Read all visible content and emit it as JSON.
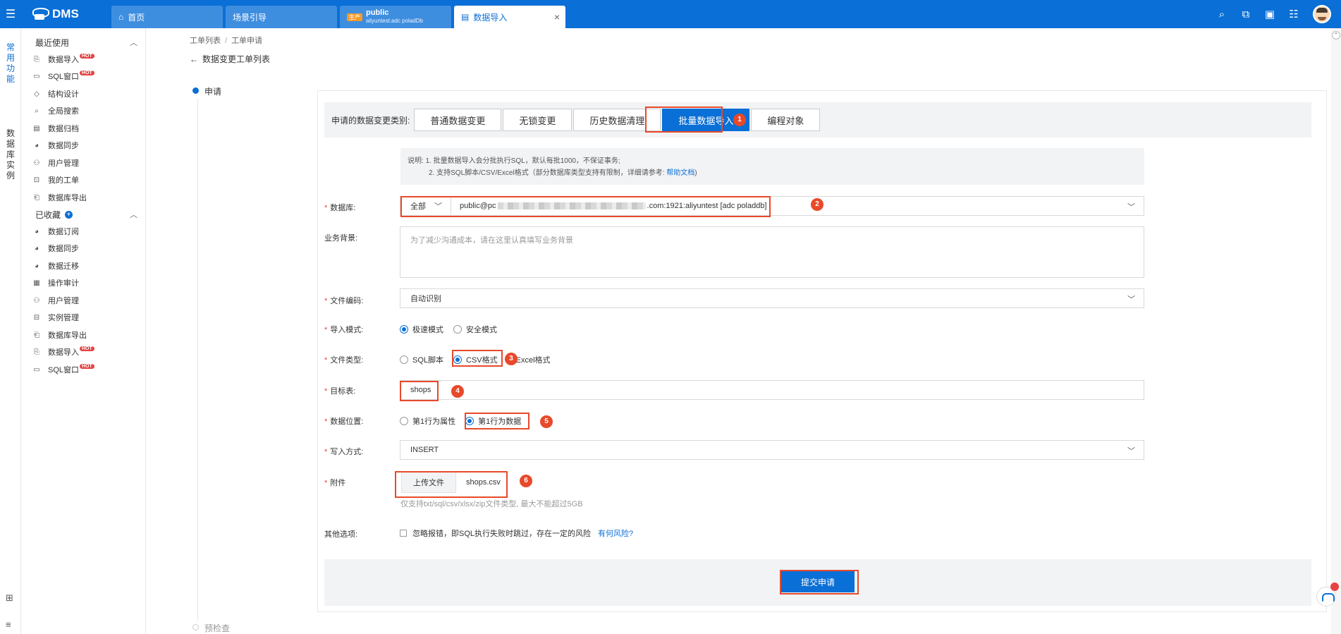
{
  "app": {
    "title": "DMS"
  },
  "tabs": [
    {
      "label": "首页"
    },
    {
      "label": "场景引导"
    },
    {
      "env": "生产",
      "label": "public",
      "sub": "aliyuntest:adc poladDb"
    },
    {
      "label": "数据导入"
    }
  ],
  "rail": {
    "item1": [
      "常",
      "用",
      "功",
      "能"
    ],
    "item2": [
      "数",
      "据",
      "库",
      "实",
      "例"
    ]
  },
  "sidebar": {
    "recent_title": "最近使用",
    "recent": [
      {
        "label": "数据导入",
        "hot": "HOT"
      },
      {
        "label": "SQL窗口",
        "hot": "HOT"
      },
      {
        "label": "结构设计"
      },
      {
        "label": "全局搜索"
      },
      {
        "label": "数据归档"
      },
      {
        "label": "数据同步"
      },
      {
        "label": "用户管理"
      },
      {
        "label": "我的工单"
      },
      {
        "label": "数据库导出"
      }
    ],
    "fav_title": "已收藏",
    "fav": [
      {
        "label": "数据订阅"
      },
      {
        "label": "数据同步"
      },
      {
        "label": "数据迁移"
      },
      {
        "label": "操作审计"
      },
      {
        "label": "用户管理"
      },
      {
        "label": "实例管理"
      },
      {
        "label": "数据库导出"
      },
      {
        "label": "数据导入",
        "hot": "HOT"
      },
      {
        "label": "SQL窗口",
        "hot": "HOT"
      }
    ]
  },
  "breadcrumb": {
    "item1": "工单列表",
    "sep": "/",
    "item2": "工单申请"
  },
  "back_title": "数据变更工单列表",
  "steps": {
    "apply": "申请",
    "precheck": "预检查"
  },
  "change_type": {
    "label": "申请的数据变更类别:",
    "options": [
      "普通数据变更",
      "无锁变更",
      "历史数据清理",
      "批量数据导入",
      "编程对象"
    ]
  },
  "note": {
    "prefix": "说明:",
    "line1": "1. 批量数据导入会分批执行SQL，默认每批1000，不保证事务;",
    "line2": "2. 支持SQL脚本/CSV/Excel格式（部分数据库类型支持有限制，详细请参考:",
    "link": "帮助文档",
    "suffix": ")"
  },
  "form": {
    "database": {
      "label": "数据库:",
      "scope": "全部",
      "value_start": "public@pc",
      "value_end": ".com:1921:aliyuntest [adc poladdb]"
    },
    "background": {
      "label": "业务背景:",
      "placeholder": "为了减少沟通成本，请在这里认真填写业务背景"
    },
    "encoding": {
      "label": "文件编码:",
      "value": "自动识别"
    },
    "import_mode": {
      "label": "导入模式:",
      "options": [
        "极速模式",
        "安全模式"
      ]
    },
    "file_type": {
      "label": "文件类型:",
      "options": [
        "SQL脚本",
        "CSV格式",
        "Excel格式"
      ]
    },
    "target_table": {
      "label": "目标表:",
      "value": "shops"
    },
    "data_position": {
      "label": "数据位置:",
      "options": [
        "第1行为属性",
        "第1行为数据"
      ]
    },
    "write_mode": {
      "label": "写入方式:",
      "value": "INSERT"
    },
    "attachment": {
      "label": "附件",
      "button": "上传文件",
      "file": "shops.csv",
      "hint": "仅支持txt/sql/csv/xlsx/zip文件类型, 最大不能超过5GB"
    },
    "other": {
      "label": "其他选项:",
      "checkbox": "忽略报错，即SQL执行失败时跳过，存在一定的风险",
      "link": "有何风险?"
    }
  },
  "submit_label": "提交申请",
  "markers": [
    "1",
    "2",
    "3",
    "4",
    "5",
    "6"
  ]
}
